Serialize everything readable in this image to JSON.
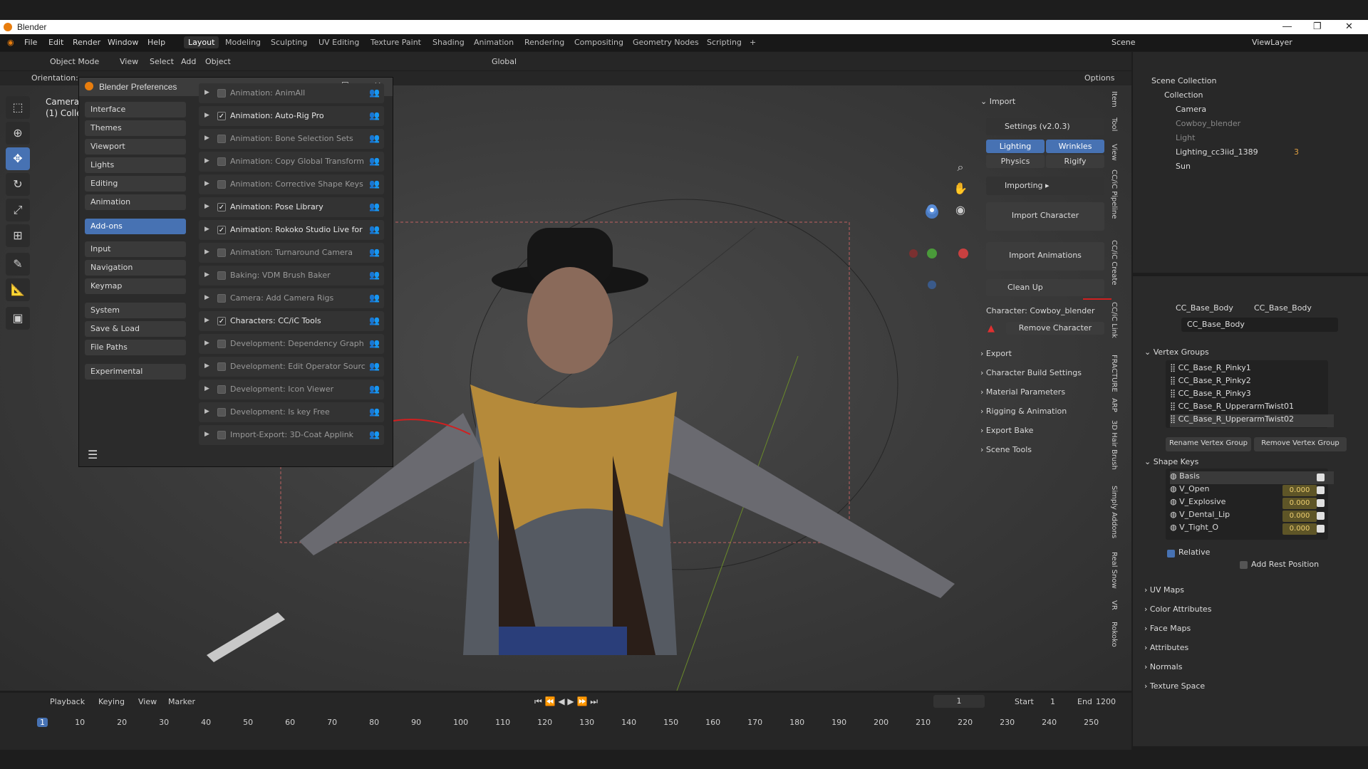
{
  "window": {
    "title": "Blender"
  },
  "menu": [
    "File",
    "Edit",
    "Render",
    "Window",
    "Help"
  ],
  "workspaces": [
    "Layout",
    "Modeling",
    "Sculpting",
    "UV Editing",
    "Texture Paint",
    "Shading",
    "Animation",
    "Rendering",
    "Compositing",
    "Geometry Nodes",
    "Scripting"
  ],
  "header": {
    "mode": "Object Mode",
    "view": "View",
    "select": "Select",
    "add": "Add",
    "object": "Object",
    "orientation_label": "Orientation:",
    "transform": "Global",
    "options": "Options",
    "scene": "Scene",
    "view_layer": "ViewLayer"
  },
  "viewport": {
    "camera_line1": "Camera I",
    "camera_line2": "(1) Colle"
  },
  "prefs": {
    "title": "Blender Preferences",
    "sidebar": [
      "Interface",
      "Themes",
      "Viewport",
      "Lights",
      "Editing",
      "Animation",
      "Add-ons",
      "Input",
      "Navigation",
      "Keymap",
      "System",
      "Save & Load",
      "File Paths",
      "Experimental"
    ],
    "addons": [
      {
        "name": "Animation: AnimAll",
        "on": false
      },
      {
        "name": "Animation: Auto-Rig Pro",
        "on": true
      },
      {
        "name": "Animation: Bone Selection Sets",
        "on": false
      },
      {
        "name": "Animation: Copy Global Transform",
        "on": false
      },
      {
        "name": "Animation: Corrective Shape Keys",
        "on": false
      },
      {
        "name": "Animation: Pose Library",
        "on": true
      },
      {
        "name": "Animation: Rokoko Studio Live for ...",
        "on": true
      },
      {
        "name": "Animation: Turnaround Camera",
        "on": false
      },
      {
        "name": "Baking: VDM Brush Baker",
        "on": false
      },
      {
        "name": "Camera: Add Camera Rigs",
        "on": false
      },
      {
        "name": "Characters: CC/iC Tools",
        "on": true
      },
      {
        "name": "Development: Dependency Graph ...",
        "on": false
      },
      {
        "name": "Development: Edit Operator Source",
        "on": false
      },
      {
        "name": "Development: Icon Viewer",
        "on": false
      },
      {
        "name": "Development: Is key Free",
        "on": false
      },
      {
        "name": "Import-Export: 3D-Coat Applink",
        "on": false
      }
    ]
  },
  "npanel": {
    "import": "Import",
    "settings": "Settings (v2.0.3)",
    "lighting": "Lighting",
    "wrinkles": "Wrinkles",
    "physics": "Physics",
    "rigify": "Rigify",
    "importing": "Importing",
    "import_character": "Import Character",
    "import_animations": "Import Animations",
    "clean_up": "Clean Up",
    "character": "Character: Cowboy_blender",
    "remove_character": "Remove Character",
    "sections": [
      "Export",
      "Character Build Settings",
      "Material Parameters",
      "Rigging & Animation",
      "Export Bake",
      "Scene Tools"
    ]
  },
  "side_tabs": [
    "Item",
    "Tool",
    "View",
    "CC/iC Pipeline",
    "CC/iC Create",
    "CC/iC Link",
    "FRACTURE",
    "ARP",
    "3D Hair Brush",
    "Simply Addons",
    "Real Snow",
    "VR",
    "Rokoko"
  ],
  "outliner": {
    "root": "Scene Collection",
    "collection": "Collection",
    "items": [
      "Camera",
      "Cowboy_blender",
      "Light",
      "Lighting_cc3iid_1389",
      "Sun"
    ],
    "badge": "3"
  },
  "properties": {
    "breadcrumb1": "CC_Base_Body",
    "breadcrumb2": "CC_Base_Body",
    "mesh": "CC_Base_Body",
    "vertex_groups_title": "Vertex Groups",
    "vertex_groups": [
      "CC_Base_R_Pinky1",
      "CC_Base_R_Pinky2",
      "CC_Base_R_Pinky3",
      "CC_Base_R_UpperarmTwist01",
      "CC_Base_R_UpperarmTwist02"
    ],
    "rename_vg": "Rename Vertex Group",
    "remove_vg": "Remove Vertex Group",
    "shape_keys_title": "Shape Keys",
    "shape_keys": [
      {
        "name": "Basis",
        "value": ""
      },
      {
        "name": "V_Open",
        "value": "0.000"
      },
      {
        "name": "V_Explosive",
        "value": "0.000"
      },
      {
        "name": "V_Dental_Lip",
        "value": "0.000"
      },
      {
        "name": "V_Tight_O",
        "value": "0.000"
      }
    ],
    "relative": "Relative",
    "add_rest": "Add Rest Position",
    "sections": [
      "UV Maps",
      "Color Attributes",
      "Face Maps",
      "Attributes",
      "Normals",
      "Texture Space"
    ]
  },
  "timeline": {
    "playback": "Playback",
    "keying": "Keying",
    "view": "View",
    "marker": "Marker",
    "current": "1",
    "start_label": "Start",
    "start": "1",
    "end_label": "End",
    "end": "1200",
    "ticks": [
      "1",
      "10",
      "20",
      "30",
      "40",
      "50",
      "60",
      "70",
      "80",
      "90",
      "100",
      "110",
      "120",
      "130",
      "140",
      "150",
      "160",
      "170",
      "180",
      "190",
      "200",
      "210",
      "220",
      "230",
      "240",
      "250"
    ]
  }
}
